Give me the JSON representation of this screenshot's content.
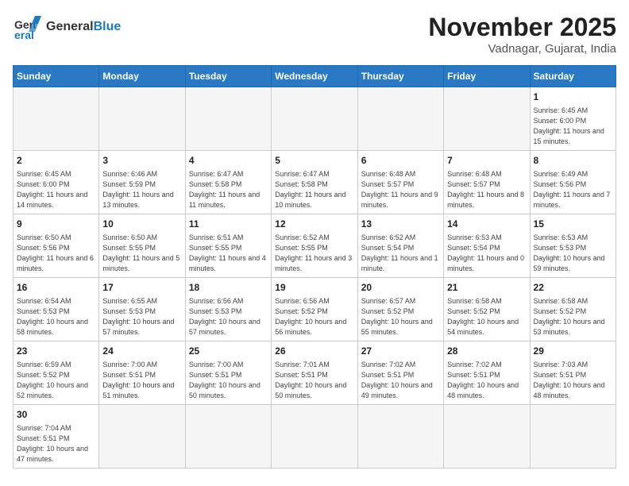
{
  "logo": {
    "general": "General",
    "blue": "Blue"
  },
  "header": {
    "month": "November 2025",
    "location": "Vadnagar, Gujarat, India"
  },
  "weekdays": [
    "Sunday",
    "Monday",
    "Tuesday",
    "Wednesday",
    "Thursday",
    "Friday",
    "Saturday"
  ],
  "weeks": [
    [
      {
        "day": "",
        "info": ""
      },
      {
        "day": "",
        "info": ""
      },
      {
        "day": "",
        "info": ""
      },
      {
        "day": "",
        "info": ""
      },
      {
        "day": "",
        "info": ""
      },
      {
        "day": "",
        "info": ""
      },
      {
        "day": "1",
        "info": "Sunrise: 6:45 AM\nSunset: 6:00 PM\nDaylight: 11 hours\nand 15 minutes."
      }
    ],
    [
      {
        "day": "2",
        "info": "Sunrise: 6:45 AM\nSunset: 6:00 PM\nDaylight: 11 hours\nand 14 minutes."
      },
      {
        "day": "3",
        "info": "Sunrise: 6:46 AM\nSunset: 5:59 PM\nDaylight: 11 hours\nand 13 minutes."
      },
      {
        "day": "4",
        "info": "Sunrise: 6:47 AM\nSunset: 5:58 PM\nDaylight: 11 hours\nand 11 minutes."
      },
      {
        "day": "5",
        "info": "Sunrise: 6:47 AM\nSunset: 5:58 PM\nDaylight: 11 hours\nand 10 minutes."
      },
      {
        "day": "6",
        "info": "Sunrise: 6:48 AM\nSunset: 5:57 PM\nDaylight: 11 hours\nand 9 minutes."
      },
      {
        "day": "7",
        "info": "Sunrise: 6:48 AM\nSunset: 5:57 PM\nDaylight: 11 hours\nand 8 minutes."
      },
      {
        "day": "8",
        "info": "Sunrise: 6:49 AM\nSunset: 5:56 PM\nDaylight: 11 hours\nand 7 minutes."
      }
    ],
    [
      {
        "day": "9",
        "info": "Sunrise: 6:50 AM\nSunset: 5:56 PM\nDaylight: 11 hours\nand 6 minutes."
      },
      {
        "day": "10",
        "info": "Sunrise: 6:50 AM\nSunset: 5:55 PM\nDaylight: 11 hours\nand 5 minutes."
      },
      {
        "day": "11",
        "info": "Sunrise: 6:51 AM\nSunset: 5:55 PM\nDaylight: 11 hours\nand 4 minutes."
      },
      {
        "day": "12",
        "info": "Sunrise: 6:52 AM\nSunset: 5:55 PM\nDaylight: 11 hours\nand 3 minutes."
      },
      {
        "day": "13",
        "info": "Sunrise: 6:52 AM\nSunset: 5:54 PM\nDaylight: 11 hours\nand 1 minute."
      },
      {
        "day": "14",
        "info": "Sunrise: 6:53 AM\nSunset: 5:54 PM\nDaylight: 11 hours\nand 0 minutes."
      },
      {
        "day": "15",
        "info": "Sunrise: 6:53 AM\nSunset: 5:53 PM\nDaylight: 10 hours\nand 59 minutes."
      }
    ],
    [
      {
        "day": "16",
        "info": "Sunrise: 6:54 AM\nSunset: 5:53 PM\nDaylight: 10 hours\nand 58 minutes."
      },
      {
        "day": "17",
        "info": "Sunrise: 6:55 AM\nSunset: 5:53 PM\nDaylight: 10 hours\nand 57 minutes."
      },
      {
        "day": "18",
        "info": "Sunrise: 6:56 AM\nSunset: 5:53 PM\nDaylight: 10 hours\nand 57 minutes."
      },
      {
        "day": "19",
        "info": "Sunrise: 6:56 AM\nSunset: 5:52 PM\nDaylight: 10 hours\nand 56 minutes."
      },
      {
        "day": "20",
        "info": "Sunrise: 6:57 AM\nSunset: 5:52 PM\nDaylight: 10 hours\nand 55 minutes."
      },
      {
        "day": "21",
        "info": "Sunrise: 6:58 AM\nSunset: 5:52 PM\nDaylight: 10 hours\nand 54 minutes."
      },
      {
        "day": "22",
        "info": "Sunrise: 6:58 AM\nSunset: 5:52 PM\nDaylight: 10 hours\nand 53 minutes."
      }
    ],
    [
      {
        "day": "23",
        "info": "Sunrise: 6:59 AM\nSunset: 5:52 PM\nDaylight: 10 hours\nand 52 minutes."
      },
      {
        "day": "24",
        "info": "Sunrise: 7:00 AM\nSunset: 5:51 PM\nDaylight: 10 hours\nand 51 minutes."
      },
      {
        "day": "25",
        "info": "Sunrise: 7:00 AM\nSunset: 5:51 PM\nDaylight: 10 hours\nand 50 minutes."
      },
      {
        "day": "26",
        "info": "Sunrise: 7:01 AM\nSunset: 5:51 PM\nDaylight: 10 hours\nand 50 minutes."
      },
      {
        "day": "27",
        "info": "Sunrise: 7:02 AM\nSunset: 5:51 PM\nDaylight: 10 hours\nand 49 minutes."
      },
      {
        "day": "28",
        "info": "Sunrise: 7:02 AM\nSunset: 5:51 PM\nDaylight: 10 hours\nand 48 minutes."
      },
      {
        "day": "29",
        "info": "Sunrise: 7:03 AM\nSunset: 5:51 PM\nDaylight: 10 hours\nand 48 minutes."
      }
    ],
    [
      {
        "day": "30",
        "info": "Sunrise: 7:04 AM\nSunset: 5:51 PM\nDaylight: 10 hours\nand 47 minutes."
      },
      {
        "day": "",
        "info": ""
      },
      {
        "day": "",
        "info": ""
      },
      {
        "day": "",
        "info": ""
      },
      {
        "day": "",
        "info": ""
      },
      {
        "day": "",
        "info": ""
      },
      {
        "day": "",
        "info": ""
      }
    ]
  ]
}
